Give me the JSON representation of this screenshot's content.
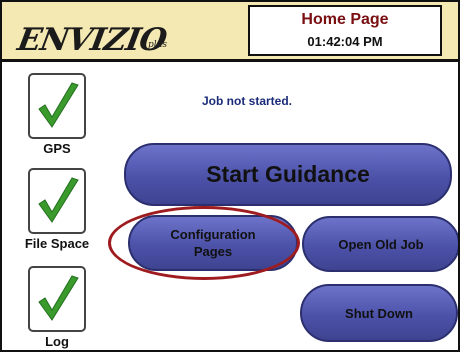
{
  "header": {
    "logo_text": "ENVIZIO",
    "logo_subtext": "plus",
    "page_title": "Home Page",
    "clock": "01:42:04 PM"
  },
  "status": {
    "gps_label": "GPS",
    "file_space_label": "File Space",
    "log_label": "Log",
    "check_icon": "green-check-icon"
  },
  "job": {
    "status_text": "Job not started."
  },
  "buttons": {
    "start_guidance": "Start Guidance",
    "configuration_pages": "Configuration\nPages",
    "open_old_job": "Open Old Job",
    "shut_down": "Shut Down"
  },
  "colors": {
    "header_bg": "#f5e9b3",
    "title_red": "#7a0f12",
    "button_blue": "#4d52a9",
    "check_green": "#3a9a2c",
    "highlight_red": "#9e1b1f"
  }
}
